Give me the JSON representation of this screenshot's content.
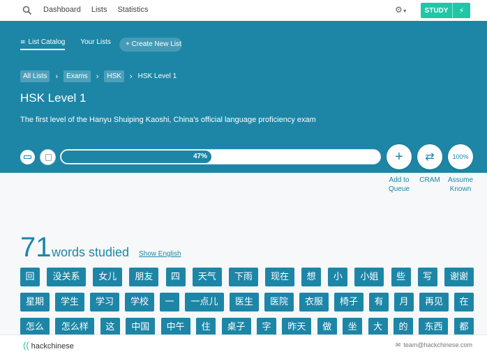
{
  "nav": {
    "links": [
      "Dashboard",
      "Lists",
      "Statistics"
    ],
    "study_label": "STUDY"
  },
  "hero": {
    "tabs": [
      "List Catalog",
      "Your Lists"
    ],
    "create_label": "+ Create New List",
    "breadcrumbs": [
      "All Lists",
      "Exams",
      "HSK"
    ],
    "breadcrumb_current": "HSK Level 1",
    "title": "HSK Level 1",
    "description": "The first level of the Hanyu Shuiping Kaoshi, China's official language proficiency exam"
  },
  "progress": {
    "percent": 47,
    "label": "47%"
  },
  "actions": {
    "add_to_queue": "Add to Queue",
    "cram": "CRAM",
    "assume_known_pct": "100%",
    "assume_known": "Assume Known"
  },
  "summary": {
    "count": "71",
    "count_label": "words studied",
    "show_english": "Show English"
  },
  "words": [
    [
      "回",
      "没关系",
      "女儿",
      "朋友",
      "四",
      "天气",
      "下雨",
      "现在",
      "想",
      "小",
      "小姐",
      "些",
      "写",
      "谢谢"
    ],
    [
      "星期",
      "学生",
      "学习",
      "学校",
      "一",
      "一点儿",
      "医生",
      "医院",
      "衣服",
      "椅子",
      "有",
      "月",
      "再见",
      "在"
    ],
    [
      "怎么",
      "怎么样",
      "这",
      "中国",
      "中午",
      "住",
      "桌子",
      "字",
      "昨天",
      "做",
      "坐",
      "大",
      "的",
      "东西",
      "都"
    ]
  ],
  "footer": {
    "brand": "hackchinese",
    "email": "team@hackchinese.com"
  },
  "colors": {
    "primary": "#1d86a7",
    "accent": "#1fc7a6"
  }
}
